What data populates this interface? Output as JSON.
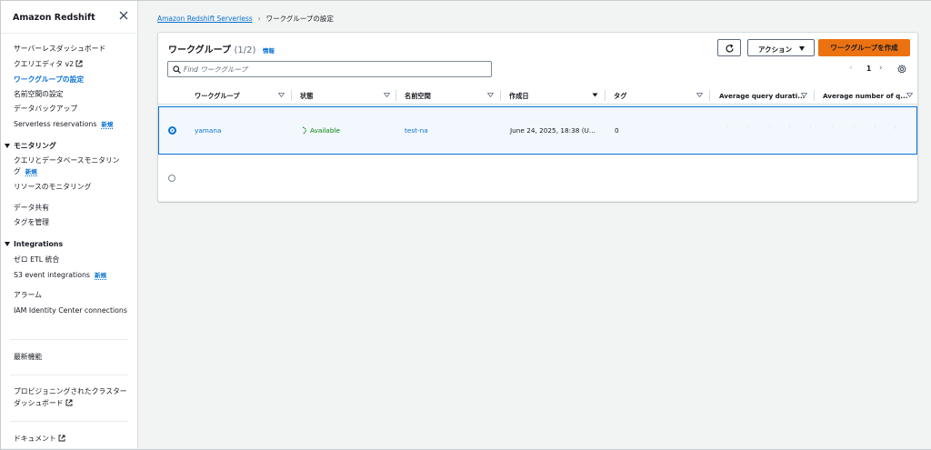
{
  "sidebar": {
    "title": "Amazon Redshift",
    "items": {
      "serverless_dashboard": "サーバーレスダッシュボード",
      "query_editor": "クエリエディタ v2",
      "workgroup_settings": "ワークグループの設定",
      "namespace_settings": "名前空間の設定",
      "data_backup": "データバックアップ",
      "serverless_reservations": "Serverless reservations",
      "monitoring_section": "モニタリング",
      "query_db_monitoring_line1": "クエリとデータベースモニタリン",
      "query_db_monitoring_line2": "グ",
      "resource_monitoring": "リソースのモニタリング",
      "data_sharing": "データ共有",
      "tag_management": "タグを管理",
      "integrations_section": "Integrations",
      "zero_etl": "ゼロ ETL 統合",
      "s3_event_integrations": "S3 event integrations",
      "alarms": "アラーム",
      "iam_identity_center": "IAM Identity Center connections",
      "whats_new": "最新機能",
      "provisioned_dashboard_line1": "プロビジョニングされたクラスター",
      "provisioned_dashboard_line2": "ダッシュボード",
      "documentation": "ドキュメント"
    },
    "new_badge": "新規"
  },
  "breadcrumb": {
    "root": "Amazon Redshift Serverless",
    "current": "ワークグループの設定"
  },
  "panel": {
    "title": "ワークグループ",
    "count": "(1/2)",
    "info": "情報",
    "actions_label": "アクション",
    "create_label": "ワークグループを作成",
    "search_placeholder": "Find ワークグループ",
    "page_number": "1",
    "prev_glyph": "‹",
    "next_glyph": "›"
  },
  "table": {
    "columns": [
      "ワークグループ",
      "状態",
      "名前空間",
      "作成日",
      "タグ",
      "Average query durati...",
      "Average number of q..."
    ],
    "rows": [
      {
        "workgroup": "yamana",
        "status": "Available",
        "namespace": "test-na",
        "created": "June 24, 2025, 18:38 (U...",
        "tags": "0",
        "selected": true
      },
      {
        "workgroup": "",
        "status": "",
        "namespace": "",
        "created": "",
        "tags": "",
        "selected": false
      }
    ]
  },
  "colors": {
    "accent": "#0972d3",
    "primary_button": "#ec7211",
    "status_available": "#037f0c",
    "selected_row_bg": "#f2f8fd"
  },
  "icons": [
    "close-icon",
    "external-link-icon",
    "refresh-icon",
    "caret-down-icon",
    "search-icon",
    "settings-icon",
    "sort-icon",
    "status-available-icon"
  ]
}
